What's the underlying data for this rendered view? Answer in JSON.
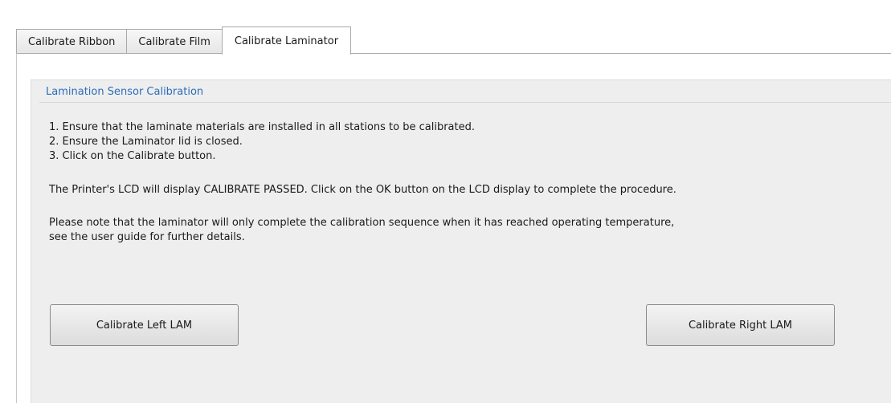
{
  "tabs": [
    {
      "label": "Calibrate Ribbon",
      "active": false
    },
    {
      "label": "Calibrate Film",
      "active": false
    },
    {
      "label": "Calibrate Laminator",
      "active": true
    }
  ],
  "group": {
    "title": "Lamination Sensor Calibration",
    "steps": [
      "1. Ensure that the laminate materials are installed in all stations to be calibrated.",
      "2. Ensure the Laminator lid is closed.",
      "3. Click on the Calibrate button."
    ],
    "lcd_note": "The Printer's LCD will display CALIBRATE PASSED.  Click on the OK button on the LCD display to complete the procedure.",
    "temperature_note_line1": "Please note that the laminator will only complete the calibration sequence when it has reached operating temperature,",
    "temperature_note_line2": "see the user guide for further details."
  },
  "buttons": {
    "left_label": "Calibrate Left LAM",
    "right_label": "Calibrate Right LAM"
  },
  "colors": {
    "group_title": "#2a6ebb",
    "panel_background": "#eeeeee"
  }
}
